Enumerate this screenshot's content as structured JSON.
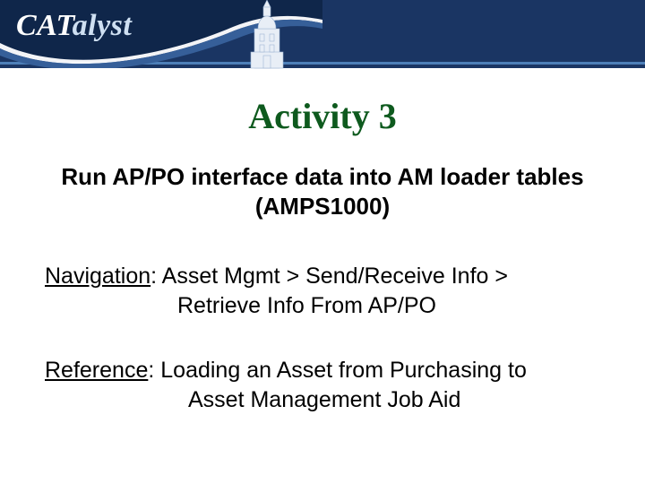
{
  "brand": {
    "prefix": "CAT",
    "suffix": "alyst"
  },
  "title": "Activity 3",
  "subtitle_line1": "Run AP/PO interface data into AM loader tables",
  "subtitle_line2": "(AMPS1000)",
  "navigation": {
    "label": "Navigation",
    "colon": ":  ",
    "text_line1": "Asset Mgmt > Send/Receive Info >",
    "text_line2": "Retrieve Info From AP/PO"
  },
  "reference": {
    "label": "Reference",
    "colon": ":  ",
    "text_line1": "Loading an Asset from Purchasing to",
    "text_line2": "Asset Management Job Aid"
  }
}
